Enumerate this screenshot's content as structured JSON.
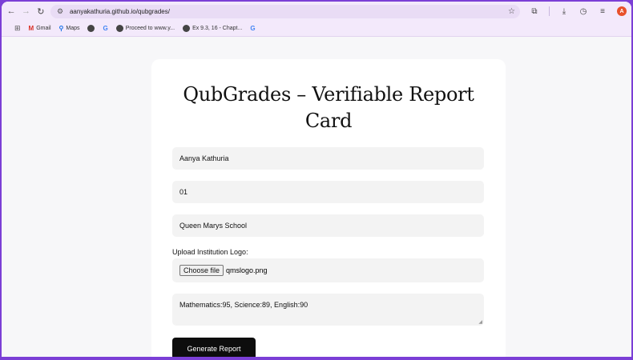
{
  "browser": {
    "url": "aanyakathuria.github.io/qubgrades/",
    "avatar_letter": "A",
    "accent": "#7b3fd6"
  },
  "bookmarks": [
    {
      "label": "Gmail",
      "icon": "gmail-icon"
    },
    {
      "label": "Maps",
      "icon": "maps-icon"
    },
    {
      "label": "",
      "icon": "globe-icon"
    },
    {
      "label": "",
      "icon": "google-icon"
    },
    {
      "label": "Proceed to www.y...",
      "icon": "globe-icon"
    },
    {
      "label": "Ex 9.3, 16 - Chapt...",
      "icon": "globe-icon"
    },
    {
      "label": "",
      "icon": "google-icon"
    }
  ],
  "form": {
    "title": "QubGrades – Verifiable Report Card",
    "student_name": "Aanya Kathuria",
    "roll_number": "01",
    "school_name": "Queen Marys School",
    "upload_label": "Upload Institution Logo:",
    "choose_file_label": "Choose file",
    "file_name": "qmslogo.png",
    "subjects": "Mathematics:95, Science:89, English:90",
    "generate_label": "Generate Report"
  }
}
